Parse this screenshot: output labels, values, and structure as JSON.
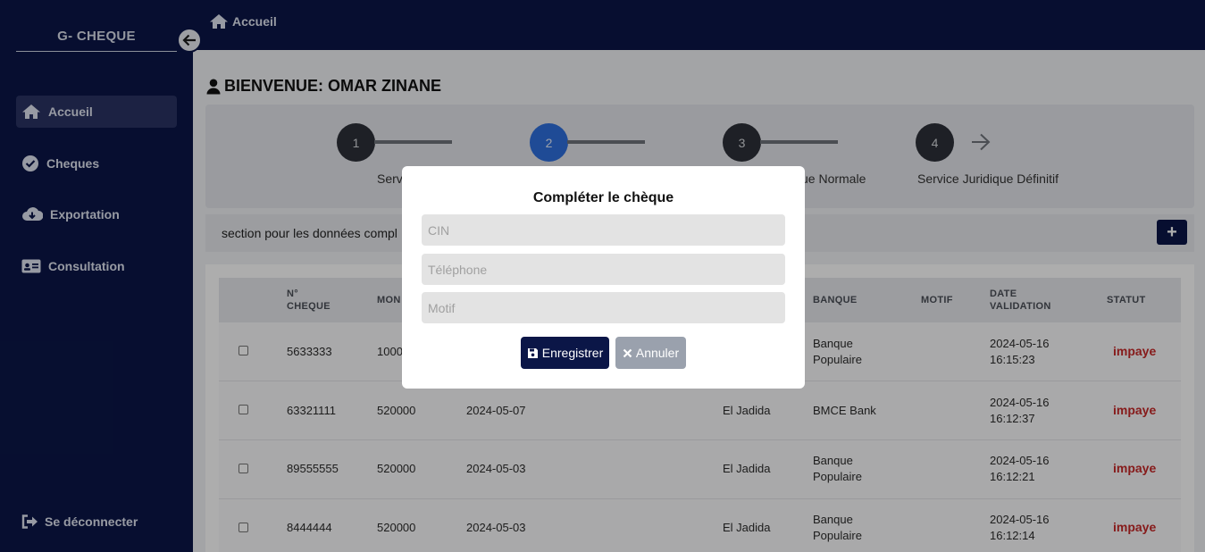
{
  "app": {
    "brand": "G- CHEQUE"
  },
  "sidebar": {
    "items": [
      {
        "label": "Accueil",
        "icon": "home-icon",
        "active": true
      },
      {
        "label": "Cheques",
        "icon": "check-circle-icon"
      },
      {
        "label": "Exportation",
        "icon": "cloud-download-icon"
      },
      {
        "label": "Consultation",
        "icon": "id-card-icon"
      }
    ],
    "logout_label": "Se déconnecter"
  },
  "topbar": {
    "breadcrumb": "Accueil"
  },
  "main": {
    "welcome": "BIENVENUE: OMAR ZINANE",
    "steps": [
      {
        "number": "1",
        "label": "Serv"
      },
      {
        "number": "2",
        "label": ""
      },
      {
        "number": "3",
        "label": "ue Normale"
      },
      {
        "number": "4",
        "label": "Service Juridique Définitif"
      }
    ],
    "section_text": "section pour les données compl",
    "add_button": "+"
  },
  "table": {
    "headers": [
      "N° CHEQUE",
      "MON",
      "BANQUE",
      "MOTIF",
      "DATE VALIDATION",
      "STATUT"
    ],
    "rows": [
      {
        "numero": "5633333",
        "montant": "1000",
        "date": "",
        "ville": "",
        "banque": "Banque Populaire",
        "motif": "",
        "validation": "2024-05-16 16:15:23",
        "statut": "impaye"
      },
      {
        "numero": "63321111",
        "montant": "520000",
        "date": "2024-05-07",
        "ville": "El Jadida",
        "banque": "BMCE Bank",
        "motif": "",
        "validation": "2024-05-16 16:12:37",
        "statut": "impaye"
      },
      {
        "numero": "89555555",
        "montant": "520000",
        "date": "2024-05-03",
        "ville": "El Jadida",
        "banque": "Banque Populaire",
        "motif": "",
        "validation": "2024-05-16 16:12:21",
        "statut": "impaye"
      },
      {
        "numero": "8444444",
        "montant": "520000",
        "date": "2024-05-03",
        "ville": "El Jadida",
        "banque": "Banque Populaire",
        "motif": "",
        "validation": "2024-05-16 16:12:14",
        "statut": "impaye"
      }
    ]
  },
  "modal": {
    "title": "Compléter le chèque",
    "fields": [
      {
        "placeholder": "CIN",
        "value": ""
      },
      {
        "placeholder": "Téléphone",
        "value": ""
      },
      {
        "placeholder": "Motif",
        "value": ""
      }
    ],
    "save_label": "Enregistrer",
    "cancel_label": "Annuler"
  },
  "colors": {
    "navy": "#0b1647",
    "step_active": "#2f6fde",
    "status_red": "#c62828"
  }
}
